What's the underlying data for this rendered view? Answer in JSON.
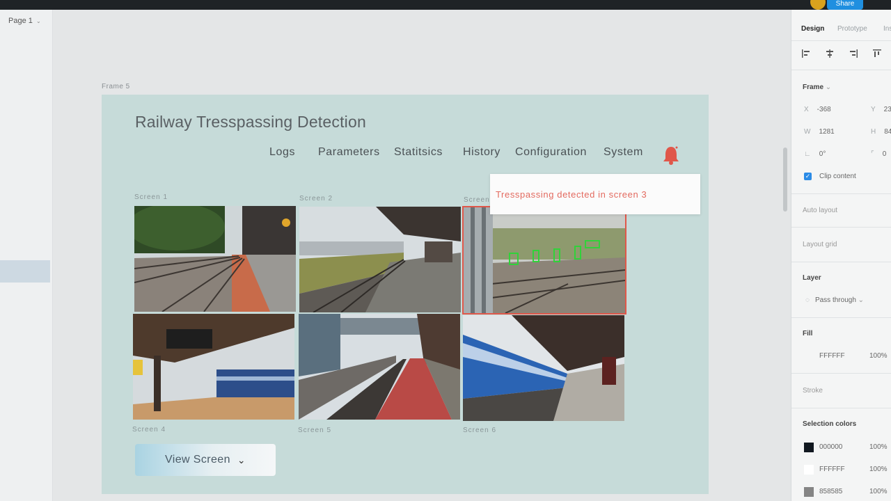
{
  "topbar": {
    "share_label": "Share"
  },
  "left_panel": {
    "page_label": "Page 1"
  },
  "canvas": {
    "frame_label": "Frame 5",
    "app": {
      "title": "Railway Tresspassing Detection",
      "nav": [
        "Logs",
        "Parameters",
        "Statitsics",
        "History",
        "Configuration",
        "System"
      ],
      "notification": "Tresspassing detected in screen 3",
      "screens": [
        {
          "label": "Screen 1"
        },
        {
          "label": "Screen 2"
        },
        {
          "label": "Screen 3"
        },
        {
          "label": "Screen 4"
        },
        {
          "label": "Screen 5"
        },
        {
          "label": "Screen 6"
        }
      ],
      "view_button": "View Screen",
      "accent": "#e0574a",
      "notification_color": "#e36a5f"
    }
  },
  "right_panel": {
    "tabs": [
      "Design",
      "Prototype",
      "Ins"
    ],
    "frame_section": "Frame",
    "fields": {
      "x": "-368",
      "y": "23",
      "w": "1281",
      "h": "84",
      "rotation": "0°",
      "radius": "0"
    },
    "clip_content": "Clip content",
    "auto_layout": "Auto layout",
    "layout_grid": "Layout grid",
    "layer": "Layer",
    "blend": "Pass through",
    "fill": "Fill",
    "fill_color": "FFFFFF",
    "fill_opacity": "100%",
    "stroke": "Stroke",
    "selection_colors": "Selection colors",
    "colors": [
      {
        "hex": "000000",
        "opacity": "100%",
        "swatch": "#111820"
      },
      {
        "hex": "FFFFFF",
        "opacity": "100%",
        "swatch": "#ffffff"
      },
      {
        "hex": "858585",
        "opacity": "100%",
        "swatch": "#858585"
      }
    ]
  }
}
